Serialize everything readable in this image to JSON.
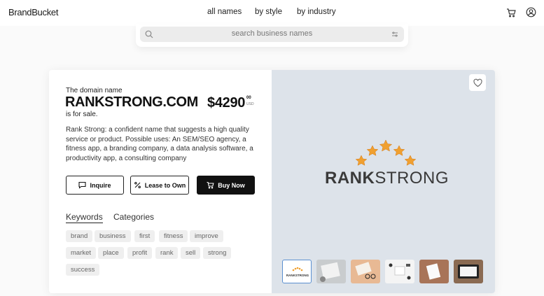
{
  "header": {
    "logo": "BrandBucket",
    "nav": [
      "all names",
      "by style",
      "by industry"
    ]
  },
  "search": {
    "placeholder": "search business names"
  },
  "listing": {
    "domain_label": "The domain name",
    "domain": "RANKSTRONG.COM",
    "price": "$4290",
    "cents": "00",
    "currency": "USD",
    "for_sale": "is for sale.",
    "description": "Rank Strong: a confident name that suggests a high quality service or product. Possible uses: An SEM/SEO agency, a fitness app, a branding company, a data analysis software, a productivity app, a consulting company",
    "buttons": {
      "inquire": "Inquire",
      "lease": "Lease to Own",
      "buy": "Buy Now"
    },
    "tabs": [
      "Keywords",
      "Categories"
    ],
    "keywords": [
      "brand",
      "business",
      "first",
      "fitness",
      "improve",
      "market",
      "place",
      "profit",
      "rank",
      "sell",
      "strong",
      "success"
    ]
  },
  "logo_preview": {
    "text_bold": "RANK",
    "text_light": "STRONG",
    "thumb_text": "RANKSTRONG"
  },
  "colors": {
    "accent_star": "#f0a030",
    "selected_thumb": "#5a8fd0",
    "preview_bg": "#dde3ea"
  }
}
